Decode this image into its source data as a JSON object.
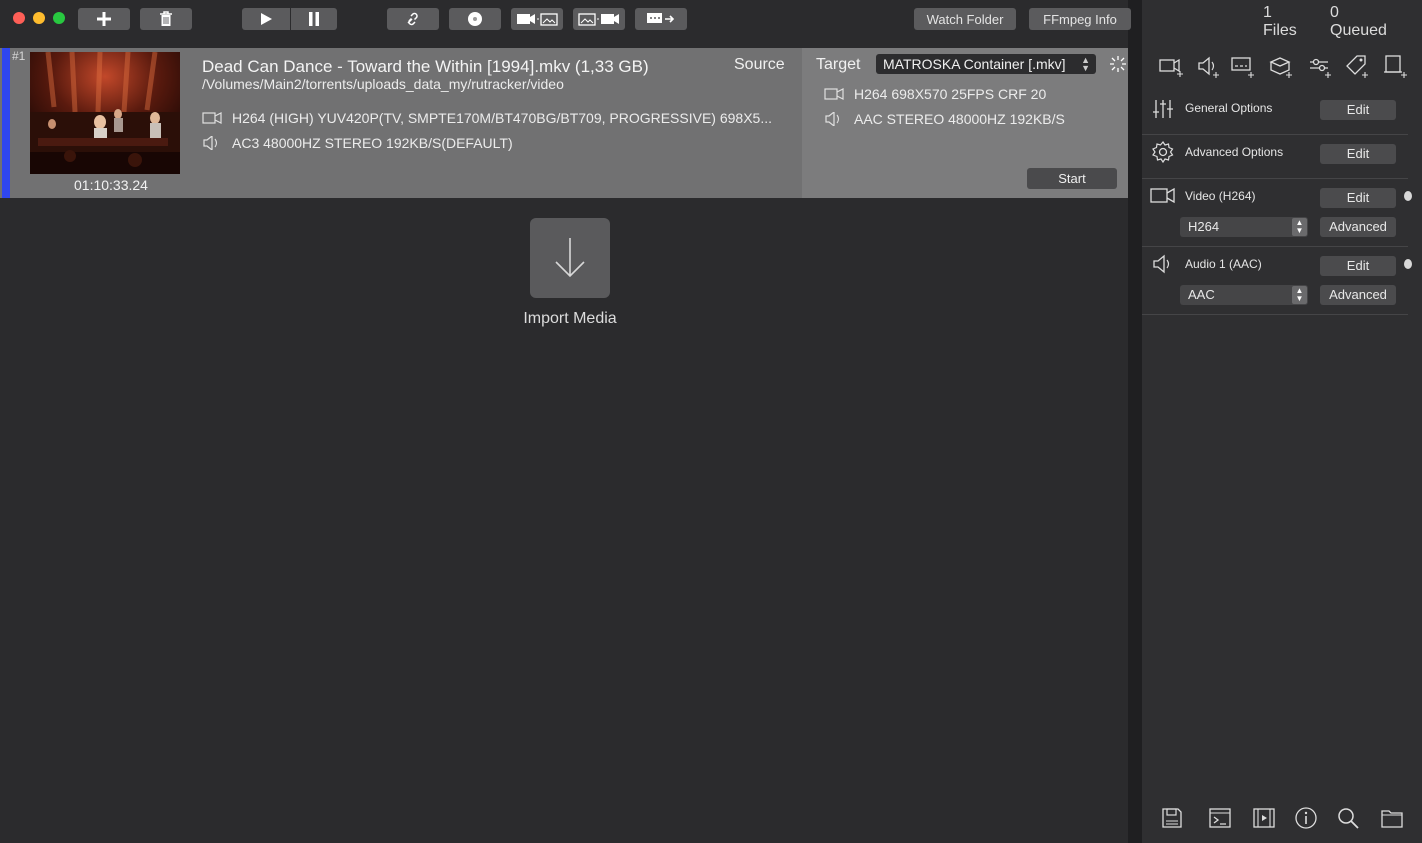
{
  "toolbar": {
    "watch_folder": "Watch Folder",
    "ffmpeg_info": "FFmpeg Info",
    "files_count": "1 Files",
    "queued_count": "0 Queued"
  },
  "item": {
    "number": "#1",
    "title": "Dead Can Dance - Toward the Within [1994].mkv  (1,33 GB)",
    "path": "/Volumes/Main2/torrents/uploads_data_my/rutracker/video",
    "duration": "01:10:33.24",
    "source_label": "Source",
    "source_video": "H264 (HIGH)  YUV420P(TV, SMPTE170M/BT470BG/BT709, PROGRESSIVE) 698X5...",
    "source_audio": "AC3 48000HZ STEREO 192KB/S(DEFAULT)",
    "target_label": "Target",
    "container": "MATROSKA Container [.mkv]",
    "target_video": "H264 698X570 25FPS CRF 20",
    "target_audio": "AAC STEREO 48000HZ 192KB/S",
    "start_label": "Start"
  },
  "import": {
    "label": "Import Media"
  },
  "sidebar": {
    "general_options": "General Options",
    "advanced_options": "Advanced Options",
    "video_label": "Video (H264)",
    "video_codec": "H264",
    "audio_label": "Audio 1 (AAC)",
    "audio_codec": "AAC",
    "edit": "Edit",
    "advanced": "Advanced"
  },
  "colors": {
    "accent_bar": "#2f46ef",
    "close": "#fe5f57",
    "minimize": "#febc2e",
    "zoom": "#28c840"
  }
}
